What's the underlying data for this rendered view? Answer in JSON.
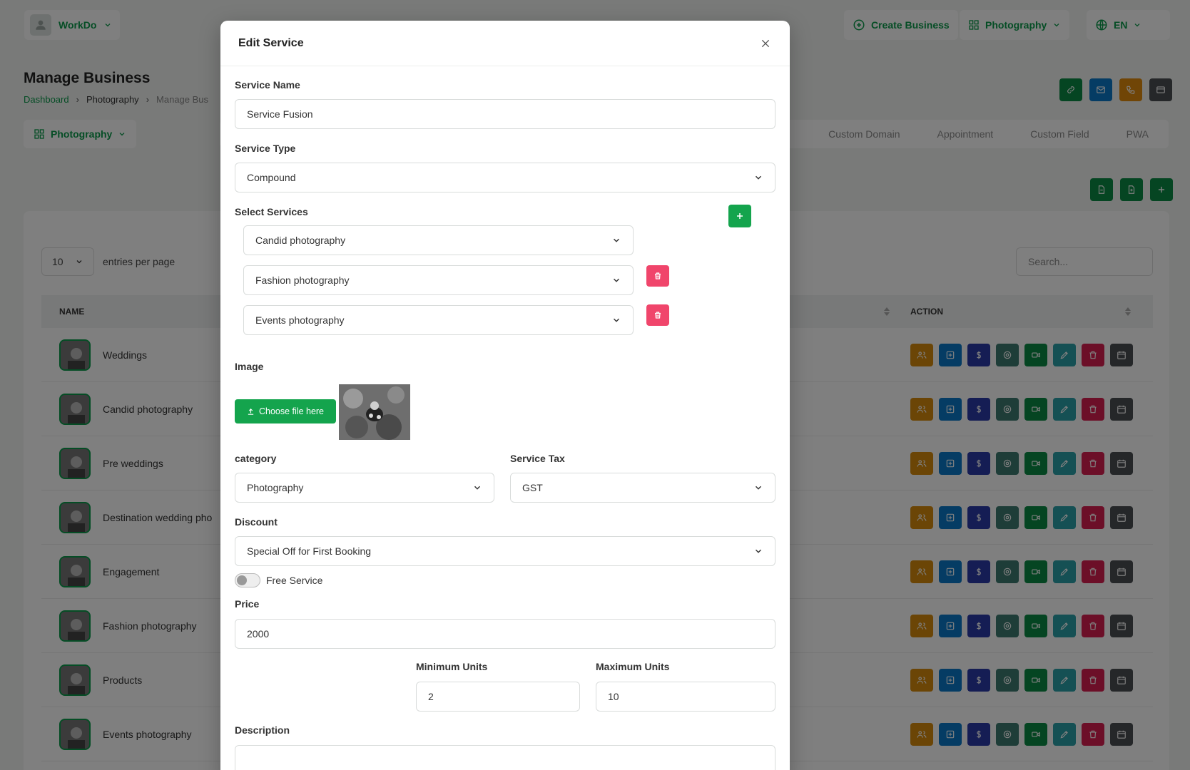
{
  "topbar": {
    "user": "WorkDo",
    "create_business": "Create Business",
    "business": "Photography",
    "language": "EN"
  },
  "page": {
    "title": "Manage Business",
    "breadcrumb": [
      "Dashboard",
      "Photography",
      "Manage Bus"
    ]
  },
  "business_select": "Photography",
  "tabs": [
    "Custom Domain",
    "Appointment",
    "Custom Field",
    "PWA"
  ],
  "table": {
    "entries_value": "10",
    "entries_label": "entries per page",
    "search_placeholder": "Search...",
    "col_name": "NAME",
    "col_action": "ACTION",
    "rows": [
      {
        "name": "Weddings"
      },
      {
        "name": "Candid photography"
      },
      {
        "name": "Pre weddings"
      },
      {
        "name": "Destination wedding pho"
      },
      {
        "name": "Engagement"
      },
      {
        "name": "Fashion photography"
      },
      {
        "name": "Products"
      },
      {
        "name": "Events photography"
      }
    ],
    "action_colors": [
      "#d68a0c",
      "#0a78c8",
      "#2b3aa8",
      "#3d7a70",
      "#0a8a44",
      "#2aa0a8",
      "#d81e50",
      "#4a4f52"
    ]
  },
  "header_icon_colors": [
    "#0a8a44",
    "#0a78c8",
    "#e08a0c",
    "#4a4f52"
  ],
  "modal": {
    "title": "Edit Service",
    "service_name_label": "Service Name",
    "service_name_value": "Service Fusion",
    "service_type_label": "Service Type",
    "service_type_value": "Compound",
    "select_services_label": "Select Services",
    "services": [
      "Candid photography",
      "Fashion photography",
      "Events photography"
    ],
    "image_label": "Image",
    "choose_file": "Choose file here",
    "category_label": "category",
    "category_value": "Photography",
    "service_tax_label": "Service Tax",
    "service_tax_value": "GST",
    "discount_label": "Discount",
    "discount_value": "Special Off for First Booking",
    "free_service_label": "Free Service",
    "price_label": "Price",
    "price_value": "2000",
    "min_units_label": "Minimum Units",
    "min_units_value": "2",
    "max_units_label": "Maximum Units",
    "max_units_value": "10",
    "description_label": "Description"
  },
  "colors": {
    "brand_green": "#14a44d",
    "delete_pink": "#f0456b"
  }
}
